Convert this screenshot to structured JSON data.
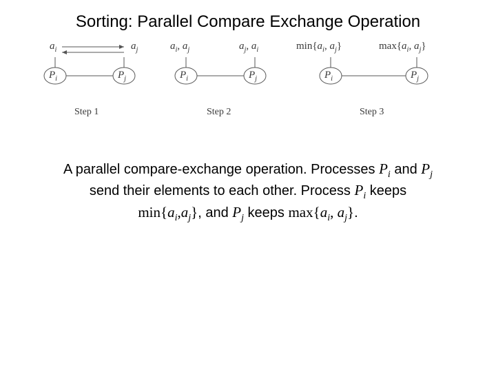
{
  "title": "Sorting: Parallel Compare Exchange Operation",
  "figure": {
    "step1": {
      "left_elem": "a",
      "left_sub": "i",
      "right_elem": "a",
      "right_sub": "j",
      "left_proc": "P",
      "left_proc_sub": "i",
      "right_proc": "P",
      "right_proc_sub": "j",
      "label": "Step 1"
    },
    "step2": {
      "pair1_a": "a",
      "pair1_a_sub": "i",
      "pair1_b": "a",
      "pair1_b_sub": "j",
      "pair2_a": "a",
      "pair2_a_sub": "j",
      "pair2_b": "a",
      "pair2_b_sub": "i",
      "left_proc": "P",
      "left_proc_sub": "i",
      "right_proc": "P",
      "right_proc_sub": "j",
      "label": "Step 2"
    },
    "step3": {
      "min_lbl": "min{",
      "min_a": "a",
      "min_a_sub": "i",
      "min_b": "a",
      "min_b_sub": "j",
      "min_close": "}",
      "max_lbl": "max{",
      "max_a": "a",
      "max_a_sub": "i",
      "max_b": "a",
      "max_b_sub": "j",
      "max_close": "}",
      "left_proc": "P",
      "left_proc_sub": "i",
      "right_proc": "P",
      "right_proc_sub": "j",
      "label": "Step 3"
    }
  },
  "caption": {
    "line1_pre": "A parallel compare-exchange operation. Processes ",
    "Pi": "P",
    "Pi_sub": "i",
    "and": " and ",
    "Pj": "P",
    "Pj_sub": "j",
    "line2_pre": "send their elements to each other. Process ",
    "Pi2": "P",
    "Pi2_sub": "i",
    "keeps": " keeps",
    "min_word": "min{",
    "ai": "a",
    "ai_sub": "i",
    "comma1": ",",
    "aj": "a",
    "aj_sub": "j",
    "close1": "}",
    "sep": ", and  ",
    "Pj2": "P",
    "Pj2_sub": "j",
    "keeps2": " keeps ",
    "max_word": "max{",
    "ai2": "a",
    "ai2_sub": "i",
    "comma2": ", ",
    "aj2": "a",
    "aj2_sub": "j",
    "close2": "}",
    "period": "."
  }
}
